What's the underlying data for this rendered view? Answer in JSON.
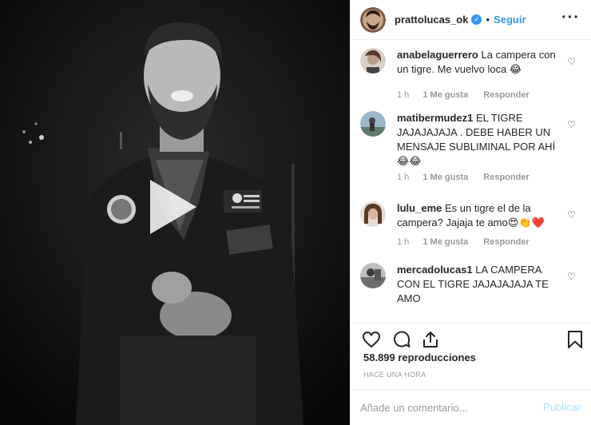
{
  "post": {
    "username": "prattolucas_ok",
    "separator": "•",
    "follow_label": "Seguir",
    "more_label": "···"
  },
  "comments": [
    {
      "username": "anabelaguerrero",
      "text": "La campera con un tigre. Me vuelvo loca 😂",
      "time": "1 h",
      "likes": "1 Me gusta",
      "reply": "Responder"
    },
    {
      "username": "matibermudez1",
      "text": "EL TIGRE JAJAJAJAJA . DEBE HABER UN MENSAJE SUBLIMINAL POR AHÍ 😂😂",
      "time": "1 h",
      "likes": "1 Me gusta",
      "reply": "Responder"
    },
    {
      "username": "lulu_eme",
      "text": "Es un tigre el de la campera? Jajaja te amo😍👏❤️",
      "time": "1 h",
      "likes": "1 Me gusta",
      "reply": "Responder"
    },
    {
      "username": "mercadolucas1",
      "text": "LA CAMPERA CON EL TIGRE JAJAJAJAJA TE AMO",
      "time": "",
      "likes": "",
      "reply": ""
    }
  ],
  "icons": {
    "like": "heart-outline-icon",
    "comment": "speech-bubble-icon",
    "share": "share-icon",
    "save": "bookmark-icon",
    "comment_like": "small-heart-icon",
    "play": "play-icon"
  },
  "stats": {
    "views": "58.899 reproducciones",
    "posted_ago": "HACE UNA HORA"
  },
  "composer": {
    "placeholder": "Añade un comentario...",
    "submit_label": "Publicar"
  },
  "colors": {
    "accent": "#3897f0",
    "verified_badge": "#3897f0",
    "muted_text": "#999999",
    "submit_disabled": "#b2dffc",
    "video_bg": "#0e0e0e"
  }
}
